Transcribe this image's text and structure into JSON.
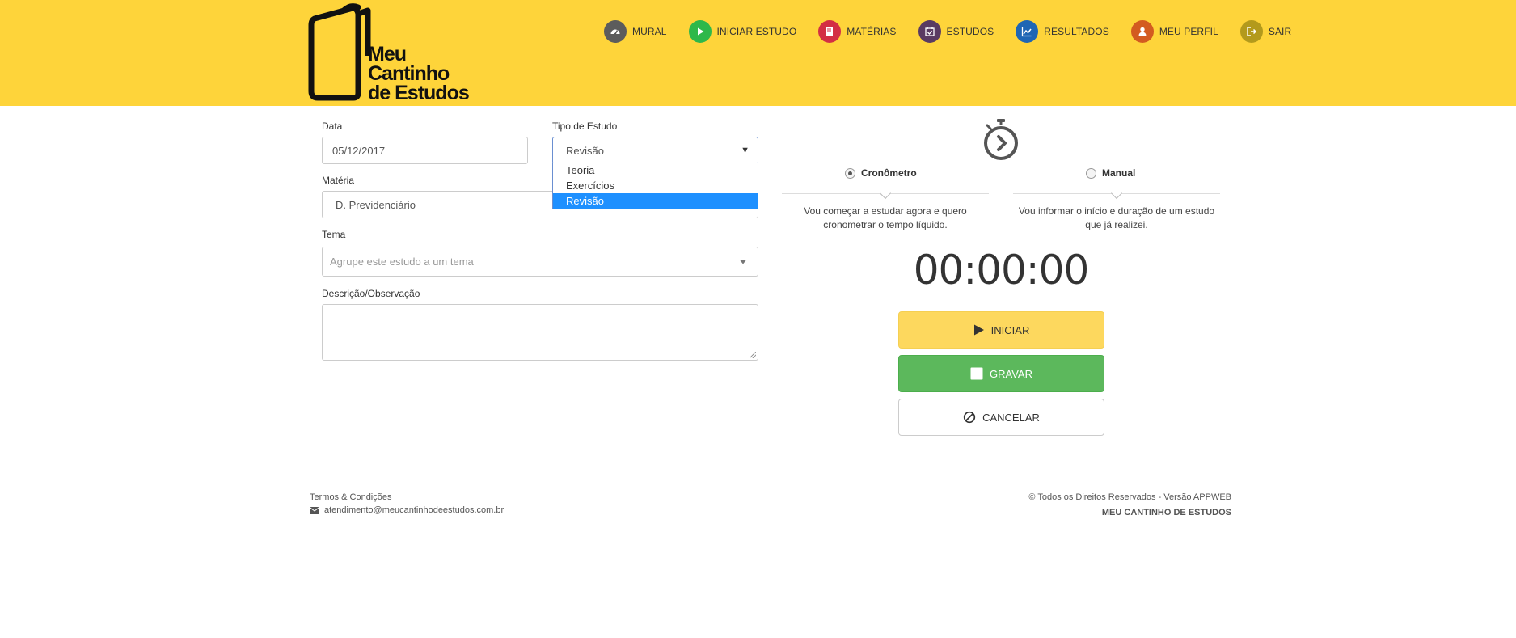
{
  "brand": {
    "line1": "Meu",
    "line2": "Cantinho",
    "line3": "de Estudos"
  },
  "nav": [
    {
      "label": "MURAL",
      "icon": "dashboard-icon",
      "color": "#5c5c5c"
    },
    {
      "label": "INICIAR ESTUDO",
      "icon": "play-icon",
      "color": "#2eb84a"
    },
    {
      "label": "MATÉRIAS",
      "icon": "book-icon",
      "color": "#d32f44"
    },
    {
      "label": "ESTUDOS",
      "icon": "calendar-check-icon",
      "color": "#5a3b62"
    },
    {
      "label": "RESULTADOS",
      "icon": "line-chart-icon",
      "color": "#1f66b4"
    },
    {
      "label": "MEU PERFIL",
      "icon": "user-icon",
      "color": "#d35b20"
    },
    {
      "label": "SAIR",
      "icon": "sign-out-icon",
      "color": "#b39a1c"
    }
  ],
  "form": {
    "date": {
      "label": "Data",
      "value": "05/12/2017"
    },
    "study_type": {
      "label": "Tipo de Estudo",
      "value": "Revisão",
      "options": [
        "Teoria",
        "Exercícios",
        "Revisão"
      ]
    },
    "subject": {
      "label": "Matéria",
      "value": "D. Previdenciário"
    },
    "theme": {
      "label": "Tema",
      "placeholder": "Agrupe este estudo a um tema"
    },
    "description": {
      "label": "Descrição/Observação"
    }
  },
  "timer_panel": {
    "mode_stopwatch": {
      "label": "Cronômetro",
      "desc_line1": "Vou começar a estudar agora e quero",
      "desc_line2": "cronometrar o tempo líquido."
    },
    "mode_manual": {
      "label": "Manual",
      "desc_line1": "Vou informar o início e duração de um estudo",
      "desc_line2": "que já realizei."
    },
    "display": "00:00:00",
    "start_label": "INICIAR",
    "save_label": "GRAVAR",
    "cancel_label": "CANCELAR"
  },
  "footer": {
    "terms": "Termos & Condições",
    "email": "atendimento@meucantinhodeestudos.com.br",
    "rights": "© Todos os Direitos Reservados - Versão APPWEB",
    "brand": "MEU CANTINHO DE ESTUDOS"
  },
  "colors": {
    "header_bg": "#fed43a",
    "start_button": "#fdd85e",
    "save_button": "#5cb85c",
    "selected_option": "#1e90ff"
  }
}
